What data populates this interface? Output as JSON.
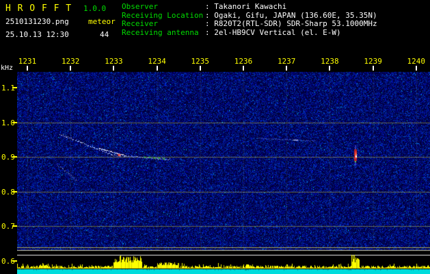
{
  "header": {
    "app_name": "H R O F F T",
    "version": "1.0.0",
    "filename": "2510131230.png",
    "mode_label": "meteor",
    "datetime": "25.10.13 12:30",
    "echo_count": "44",
    "station_info": [
      {
        "label": "Observer",
        "value": ": Takanori Kawachi"
      },
      {
        "label": "Receiving Location",
        "value": ": Ogaki, Gifu, JAPAN (136.60E, 35.35N)"
      },
      {
        "label": "Receiver",
        "value": ": R820T2(RTL-SDR) SDR-Sharp 53.1000MHz"
      },
      {
        "label": "Receiving antenna",
        "value": ": 2el-HB9CV Vertical (el. E-W)"
      }
    ]
  },
  "chart_data": {
    "type": "heatmap",
    "title": "HROFFT 10-minute radio meteor spectrogram",
    "ylabel": "kHz",
    "xlabel": "",
    "x_tick_labels": [
      "1231",
      "1232",
      "1233",
      "1234",
      "1235",
      "1236",
      "1237",
      "1238",
      "1239",
      "1240"
    ],
    "y_tick_labels": [
      "1.1",
      "1.0",
      "0.9",
      "0.8",
      "0.7",
      "0.6"
    ],
    "y_tick_khz": [
      1.1,
      1.0,
      0.9,
      0.8,
      0.7,
      0.6
    ],
    "grid_khz": [
      1.0,
      0.9,
      0.8,
      0.7
    ],
    "grid": true,
    "legend_position": "none",
    "meteor_echoes": [
      {
        "t0": 1231.76,
        "f0": 0.965,
        "t1": 1234.3,
        "f1": 0.893,
        "kind": "long drifting echo trace (cyan/white with red-green core)"
      },
      {
        "t0": 1231.7,
        "f0": 0.878,
        "t1": 1232.15,
        "f1": 0.832,
        "kind": "faint short drifting trace"
      },
      {
        "t0": 1238.58,
        "f0": 0.918,
        "t1": 1238.58,
        "f1": 0.886,
        "kind": "strong saturated echo (red with white core)"
      }
    ],
    "activity_spikes": [
      {
        "t": 1231.28,
        "t_end": 1231.45,
        "peak": 8
      },
      {
        "t": 1233.0,
        "t_end": 1233.65,
        "peak": 19
      },
      {
        "t": 1234.0,
        "t_end": 1234.5,
        "peak": 9
      },
      {
        "t": 1236.05,
        "t_end": 1236.2,
        "peak": 6
      },
      {
        "t": 1238.5,
        "t_end": 1238.68,
        "peak": 20
      }
    ]
  },
  "palette": {
    "background": "#000000",
    "noise_base_blue": "#000060",
    "axis_text_yellow": "#ffff00",
    "header_label_green": "#00dd00",
    "header_value_white": "#ffffff",
    "grid_olive": "#b8b83c",
    "histogram_yellow": "#ffff00",
    "band_cyan": "#00dcdc",
    "strong_echo_red": "#e83030",
    "echo_trace_blue": "#aac4ff",
    "echo_green": "#3fae3f"
  }
}
